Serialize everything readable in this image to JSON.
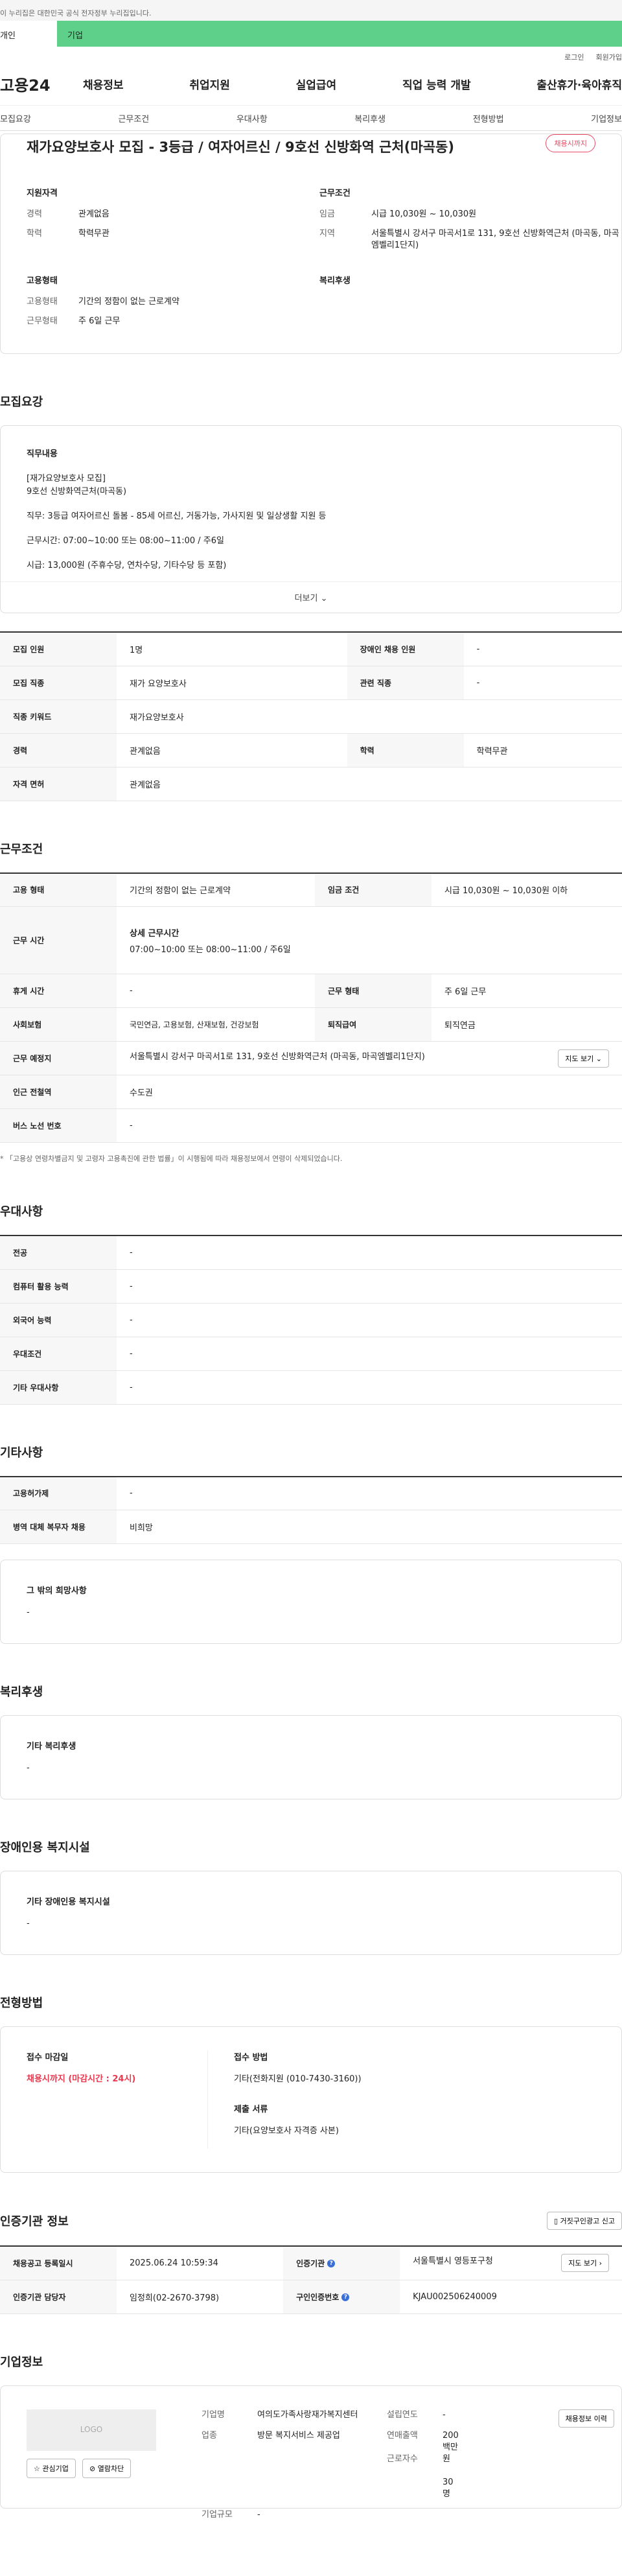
{
  "gov_bar": "이 누리집은 대한민국 공식 전자정부 누리집입니다.",
  "top_tabs": [
    "개인",
    "기업"
  ],
  "util": [
    "로그인",
    "회원가입"
  ],
  "logo": "고용24",
  "gnb": [
    "채용정보",
    "취업지원",
    "실업급여",
    "직업 능력 개발",
    "출산휴가·육아휴직"
  ],
  "anchors": [
    "모집요강",
    "근무조건",
    "우대사항",
    "복리후생",
    "전형방법",
    "기업정보"
  ],
  "summary": {
    "title": "재가요양보호사 모집 - 3등급 / 여자어르신 / 9호선 신방화역 근처(마곡동)",
    "badge": "채용시까지",
    "qual_h": "지원자격",
    "career_k": "경력",
    "career_v": "관계없음",
    "edu_k": "학력",
    "edu_v": "학력무관",
    "cond_h": "근무조건",
    "wage_k": "임금",
    "wage_v": "시급 10,030원 ~ 10,030원",
    "region_k": "지역",
    "region_v": "서울특별시 강서구 마곡서1로 131, 9호선 신방화역근처 (마곡동, 마곡엠벨리1단지)",
    "emp_h": "고용형태",
    "emptype_k": "고용형태",
    "emptype_v": "기간의 정함이 없는 근로계약",
    "worktype_k": "근무형태",
    "worktype_v": "주 6일 근무",
    "welfare_h": "복리후생"
  },
  "recruit": {
    "title": "모집요강",
    "desc_h": "직무내용",
    "desc_lines": [
      "[재가요양보호사 모집]",
      "9호선 신방화역근처(마곡동)",
      "직무: 3등급 여자어르신 돌봄 - 85세 어르신, 거동가능, 가사지원 및 일상생활 지원 등",
      "근무시간: 07:00~10:00 또는 08:00~11:00 / 주6일",
      "시급: 13,000원 (주휴수당, 연차수당, 기타수당 등 포함)"
    ],
    "more": "더보기",
    "rows": [
      [
        "모집 인원",
        "1명",
        "장애인 채용 인원",
        "-"
      ],
      [
        "모집 직종",
        "재가 요양보호사",
        "관련 직종",
        "-"
      ],
      [
        "직종 키워드",
        "재가요양보호사"
      ],
      [
        "경력",
        "관계없음",
        "학력",
        "학력무관"
      ],
      [
        "자격 면허",
        "관계없음"
      ]
    ]
  },
  "conditions": {
    "title": "근무조건",
    "emptype": [
      "고용 형태",
      "기간의 정함이 없는 근로계약",
      "임금 조건",
      "시급 10,030원 ~ 10,030원 이하"
    ],
    "hours_k": "근무 시간",
    "hours_sub": "상세 근무시간",
    "hours_v": "07:00~10:00 또는 08:00~11:00 / 주6일",
    "rest": [
      "휴게 시간",
      "-",
      "근무 형태",
      "주 6일 근무"
    ],
    "insurance": [
      "사회보험",
      "국민연금, 고용보험, 산재보험, 건강보험",
      "퇴직급여",
      "퇴직연금"
    ],
    "place_k": "근무 예정지",
    "place_v": "서울특별시 강서구 마곡서1로 131, 9호선 신방화역근처 (마곡동, 마곡엠벨리1단지)",
    "map_btn": "지도 보기",
    "subway": [
      "인근 전철역",
      "수도권"
    ],
    "bus": [
      "버스 노선 번호",
      "-"
    ],
    "note": "* 「고용상 연령차별금지 및 고령자 고용촉진에 관한 법률」이 시행됨에 따라 채용정보에서 연령이 삭제되었습니다."
  },
  "preference": {
    "title": "우대사항",
    "rows": [
      [
        "전공",
        "-"
      ],
      [
        "컴퓨터 활용 능력",
        "-"
      ],
      [
        "외국어 능력",
        "-"
      ],
      [
        "우대조건",
        "-"
      ],
      [
        "기타 우대사항",
        "-"
      ]
    ]
  },
  "etc": {
    "title": "기타사항",
    "rows": [
      [
        "고용허가제",
        "-"
      ],
      [
        "병역 대체 복무자 채용",
        "비희망"
      ]
    ],
    "box_h": "그 밖의 희망사항",
    "box_v": "-"
  },
  "welfare": {
    "title": "복리후생",
    "box_h": "기타 복리후생",
    "box_v": "-"
  },
  "disability": {
    "title": "장애인용 복지시설",
    "box_h": "기타 장애인용 복지시설",
    "box_v": "-"
  },
  "method": {
    "title": "전형방법",
    "deadline_h": "접수 마감일",
    "deadline_v": "채용시까지 (마감시간 : 24시)",
    "apply_h": "접수 방법",
    "apply_v": "기타(전화지원 (010-7430-3160))",
    "docs_h": "제출 서류",
    "docs_v": "기타(요양보호사 자격증 사본)"
  },
  "agency": {
    "title": "인증기관 정보",
    "report_btn": "거짓구인광고 신고",
    "r1": [
      "채용공고 등록일시",
      "2025.06.24 10:59:34",
      "인증기관",
      "서울특별시 영등포구청"
    ],
    "map_btn": "지도 보기",
    "r2": [
      "인증기관 담당자",
      "임정희(02-2670-3798)",
      "구인인증번호",
      "KJAU002506240009"
    ]
  },
  "company": {
    "title": "기업정보",
    "logo": "LOGO",
    "fav_btn": "관심기업",
    "block_btn": "열람차단",
    "name_k": "기업명",
    "name_v": "여의도가족사랑재가복지센터",
    "year_k": "설립연도",
    "year_v": "-",
    "industry_k": "업종",
    "industry_v": "방문 복지서비스 제공업",
    "sales_k": "연매출액",
    "sales_v": "200 백만원",
    "emp_k": "근로자수",
    "emp_v": "30명",
    "size_k": "기업규모",
    "size_v": "-",
    "history_btn": "채용정보 이력"
  },
  "colors": {
    "accent_green": "#5fd089",
    "deadline_red": "#e84b63",
    "info_blue": "#3a6fd8"
  }
}
